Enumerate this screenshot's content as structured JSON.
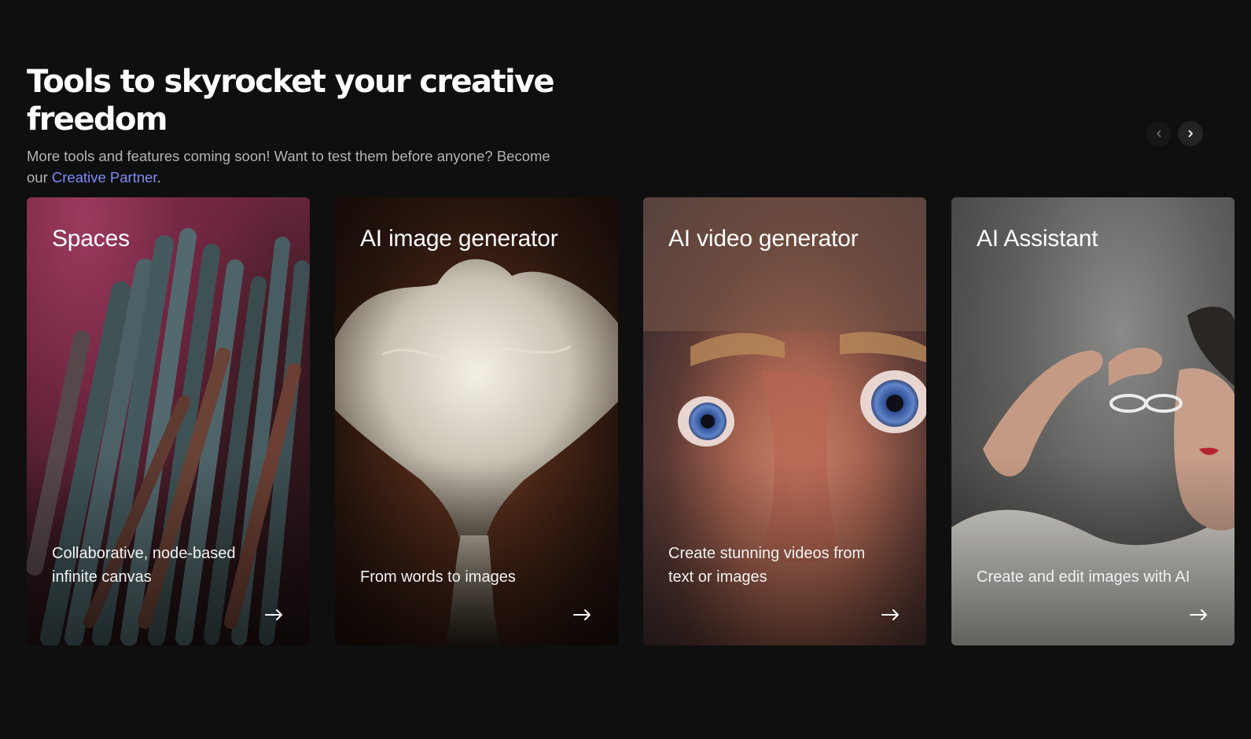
{
  "header": {
    "title": "Tools to skyrocket your creative freedom",
    "subtitle_before": "More tools and features coming soon! Want to test them before anyone? Become our ",
    "subtitle_link": "Creative Partner",
    "subtitle_after": "."
  },
  "nav": {
    "prev_icon": "chevron-left-icon",
    "next_icon": "chevron-right-icon"
  },
  "cards": [
    {
      "title": "Spaces",
      "description": "Collaborative, node-based infinite canvas",
      "arrow_icon": "arrow-right-icon"
    },
    {
      "title": "AI image generator",
      "description": "From words to images",
      "arrow_icon": "arrow-right-icon"
    },
    {
      "title": "AI video generator",
      "description": "Create stunning videos from text or images",
      "arrow_icon": "arrow-right-icon"
    },
    {
      "title": "AI Assistant",
      "description": "Create and edit images with AI",
      "arrow_icon": "arrow-right-icon"
    }
  ],
  "colors": {
    "background": "#0f0f0f",
    "link": "#7d8cf7",
    "subtitle": "#b4b4b4"
  }
}
